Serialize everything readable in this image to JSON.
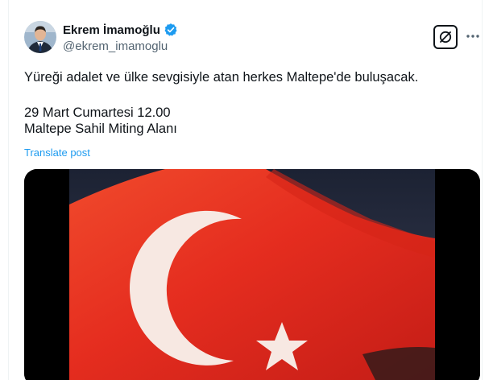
{
  "author": {
    "display_name": "Ekrem İmamoğlu",
    "handle": "@ekrem_imamoglu",
    "avatar_icon": "avatar-photo",
    "verified_icon": "verified-badge-icon"
  },
  "tweet": {
    "lines": [
      "Yüreği adalet ve ülke sevgisiyle atan herkes Maltepe'de buluşacak.",
      "29 Mart Cumartesi 12.00",
      "Maltepe Sahil Miting Alanı"
    ],
    "translate_label": "Translate post"
  },
  "actions": {
    "grok_icon": "grok-icon",
    "more_icon": "more-options-icon"
  },
  "media": {
    "content_icon": "turkish-flag-video"
  },
  "colors": {
    "accent": "#1d9bf0",
    "text": "#0f1419",
    "secondary": "#536471",
    "flag_red": "#e8281e"
  }
}
